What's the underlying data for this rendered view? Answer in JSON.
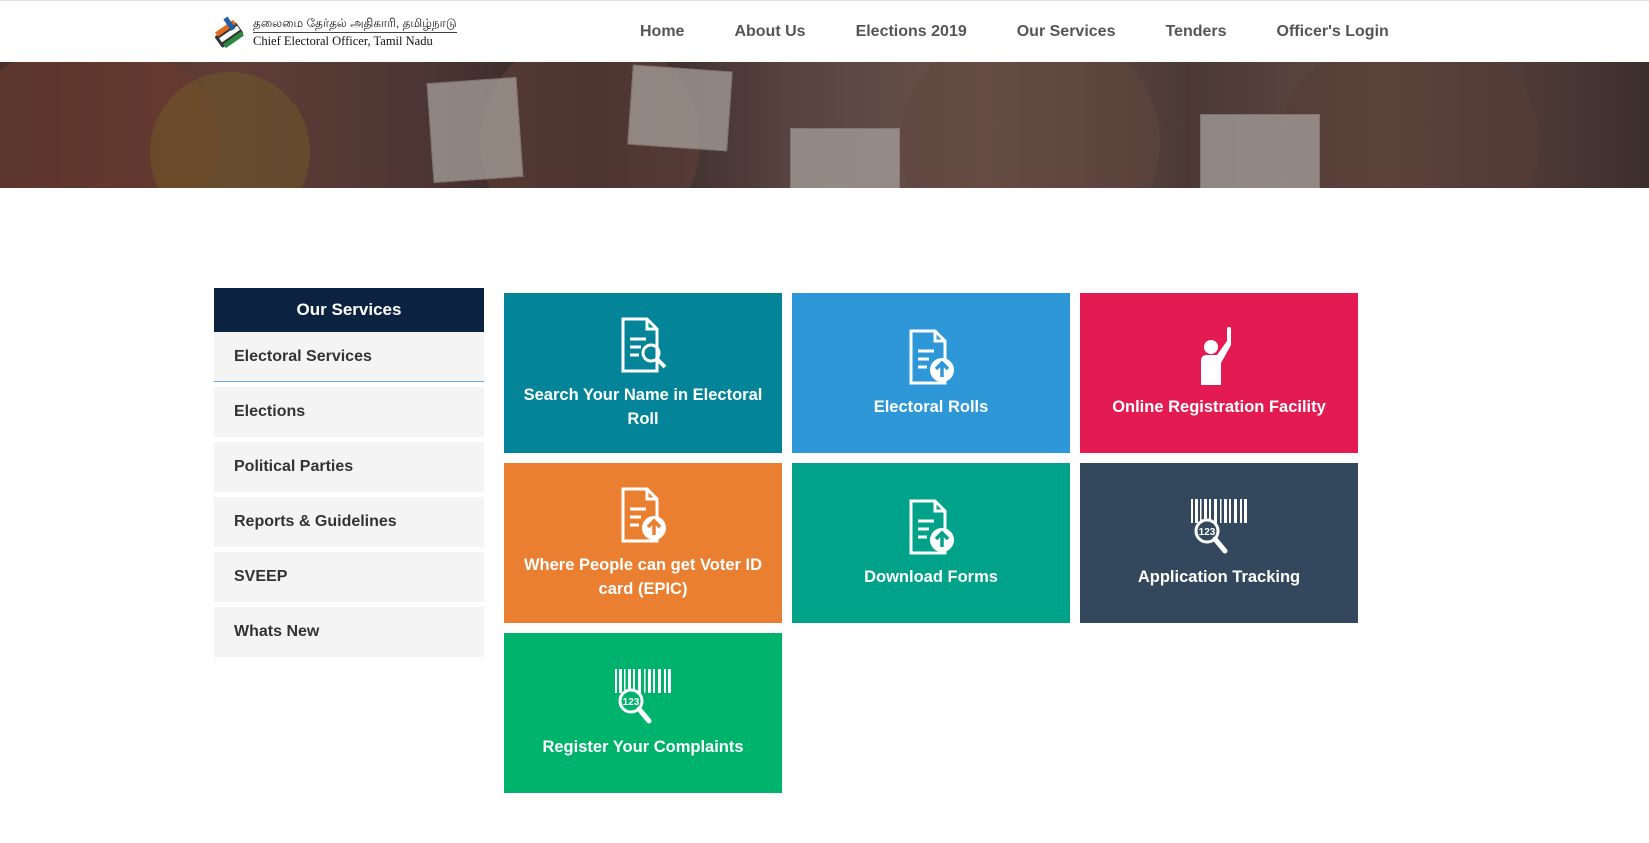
{
  "header": {
    "logo_tamil": "தலைமை தேர்தல் அதிகாரி, தமிழ்நாடு",
    "logo_english": "Chief Electoral Officer, Tamil Nadu",
    "nav": [
      {
        "label": "Home"
      },
      {
        "label": "About Us"
      },
      {
        "label": "Elections 2019"
      },
      {
        "label": "Our Services"
      },
      {
        "label": "Tenders"
      },
      {
        "label": "Officer's Login"
      }
    ]
  },
  "sidebar": {
    "title": "Our Services",
    "items": [
      {
        "label": "Electoral Services"
      },
      {
        "label": "Elections"
      },
      {
        "label": "Political Parties"
      },
      {
        "label": "Reports & Guidelines"
      },
      {
        "label": "SVEEP"
      },
      {
        "label": "Whats New"
      }
    ]
  },
  "tiles": [
    {
      "label": "Search Your Name in Electoral Roll",
      "color": "#048499",
      "icon": "document-search-icon"
    },
    {
      "label": "Electoral Rolls",
      "color": "#2e97d8",
      "icon": "document-upload-icon"
    },
    {
      "label": "Online Registration Facility",
      "color": "#e31b52",
      "icon": "raised-hand-icon"
    },
    {
      "label": "Where People can get Voter ID card (EPIC)",
      "color": "#eb7f31",
      "icon": "document-upload-icon"
    },
    {
      "label": "Download Forms",
      "color": "#00a389",
      "icon": "document-upload-icon"
    },
    {
      "label": "Application Tracking",
      "color": "#34485d",
      "icon": "barcode-search-icon"
    },
    {
      "label": "Register Your Complaints",
      "color": "#00b36c",
      "icon": "barcode-search-icon"
    }
  ],
  "colors": {
    "sidebar_header": "#0b2340",
    "sidebar_item_bg": "#f4f4f4",
    "nav_text": "#555555"
  }
}
